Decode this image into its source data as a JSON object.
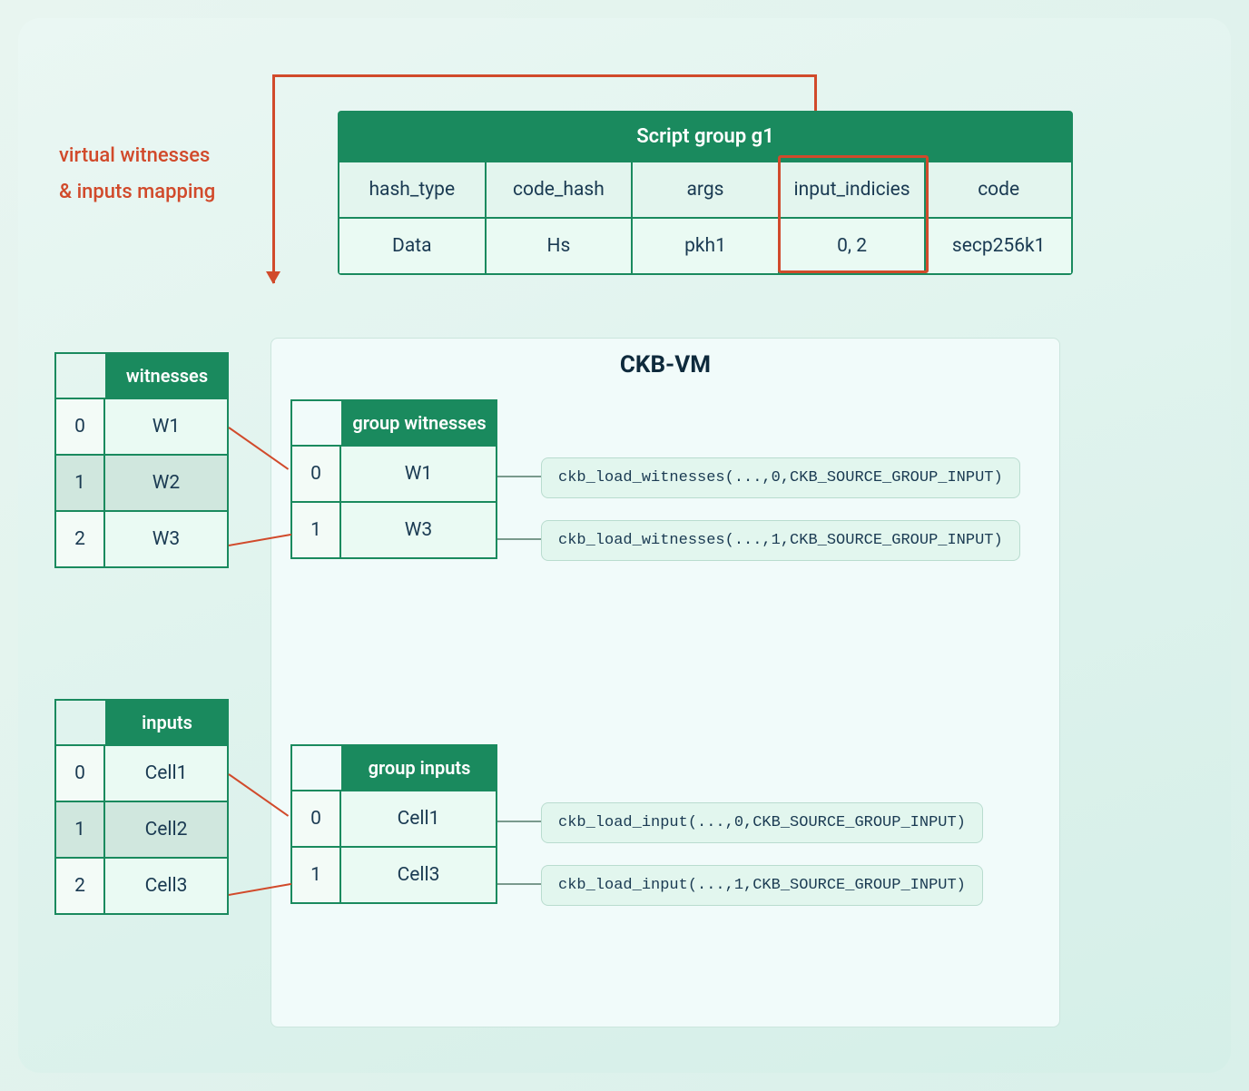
{
  "mapping_label_line1": "virtual witnesses",
  "mapping_label_line2": "& inputs mapping",
  "script_group": {
    "title": "Script group g1",
    "headers": [
      "hash_type",
      "code_hash",
      "args",
      "input_indicies",
      "code"
    ],
    "values": [
      "Data",
      "Hs",
      "pkh1",
      "0, 2",
      "secp256k1"
    ]
  },
  "ckbvm_title": "CKB-VM",
  "witnesses": {
    "title": "witnesses",
    "rows": [
      {
        "idx": "0",
        "val": "W1"
      },
      {
        "idx": "1",
        "val": "W2"
      },
      {
        "idx": "2",
        "val": "W3"
      }
    ]
  },
  "inputs": {
    "title": "inputs",
    "rows": [
      {
        "idx": "0",
        "val": "Cell1"
      },
      {
        "idx": "1",
        "val": "Cell2"
      },
      {
        "idx": "2",
        "val": "Cell3"
      }
    ]
  },
  "group_witnesses": {
    "title": "group witnesses",
    "rows": [
      {
        "idx": "0",
        "val": "W1"
      },
      {
        "idx": "1",
        "val": "W3"
      }
    ]
  },
  "group_inputs": {
    "title": "group inputs",
    "rows": [
      {
        "idx": "0",
        "val": "Cell1"
      },
      {
        "idx": "1",
        "val": "Cell3"
      }
    ]
  },
  "code_calls": {
    "w0": "ckb_load_witnesses(...,0,CKB_SOURCE_GROUP_INPUT)",
    "w1": "ckb_load_witnesses(...,1,CKB_SOURCE_GROUP_INPUT)",
    "i0": "ckb_load_input(...,0,CKB_SOURCE_GROUP_INPUT)",
    "i1": "ckb_load_input(...,1,CKB_SOURCE_GROUP_INPUT)"
  }
}
